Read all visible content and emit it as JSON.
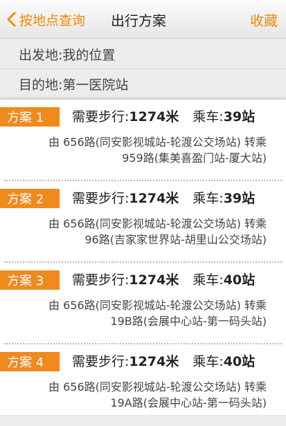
{
  "nav": {
    "back_label": "按地点查询",
    "title": "出行方案",
    "favorite_label": "收藏"
  },
  "route": {
    "origin": "出发地:我的位置",
    "destination": "目的地:第一医院站"
  },
  "plans": [
    {
      "tag": "方案 1",
      "walk_label": "需要步行:",
      "walk_value": "1274米",
      "ride_label": "乘车:",
      "ride_value": "39站",
      "detail_line1": "由 656路(同安影视城站-轮渡公交场站) 转乘",
      "detail_line2": "959路(集美喜盈门站-厦大站)"
    },
    {
      "tag": "方案 2",
      "walk_label": "需要步行:",
      "walk_value": "1274米",
      "ride_label": "乘车:",
      "ride_value": "39站",
      "detail_line1": "由 656路(同安影视城站-轮渡公交场站) 转乘",
      "detail_line2": "96路(吉家家世界站-胡里山公交场站)"
    },
    {
      "tag": "方案 3",
      "walk_label": "需要步行:",
      "walk_value": "1274米",
      "ride_label": "乘车:",
      "ride_value": "40站",
      "detail_line1": "由 656路(同安影视城站-轮渡公交场站) 转乘",
      "detail_line2": "19B路(会展中心站-第一码头站)"
    },
    {
      "tag": "方案 4",
      "walk_label": "需要步行:",
      "walk_value": "1274米",
      "ride_label": "乘车:",
      "ride_value": "40站",
      "detail_line1": "由 656路(同安影视城站-轮渡公交场站) 转乘",
      "detail_line2": "19A路(会展中心站-第一码头站)"
    }
  ],
  "colors": {
    "accent": "#f08a00",
    "tag_bg": "#ef8a1f"
  }
}
